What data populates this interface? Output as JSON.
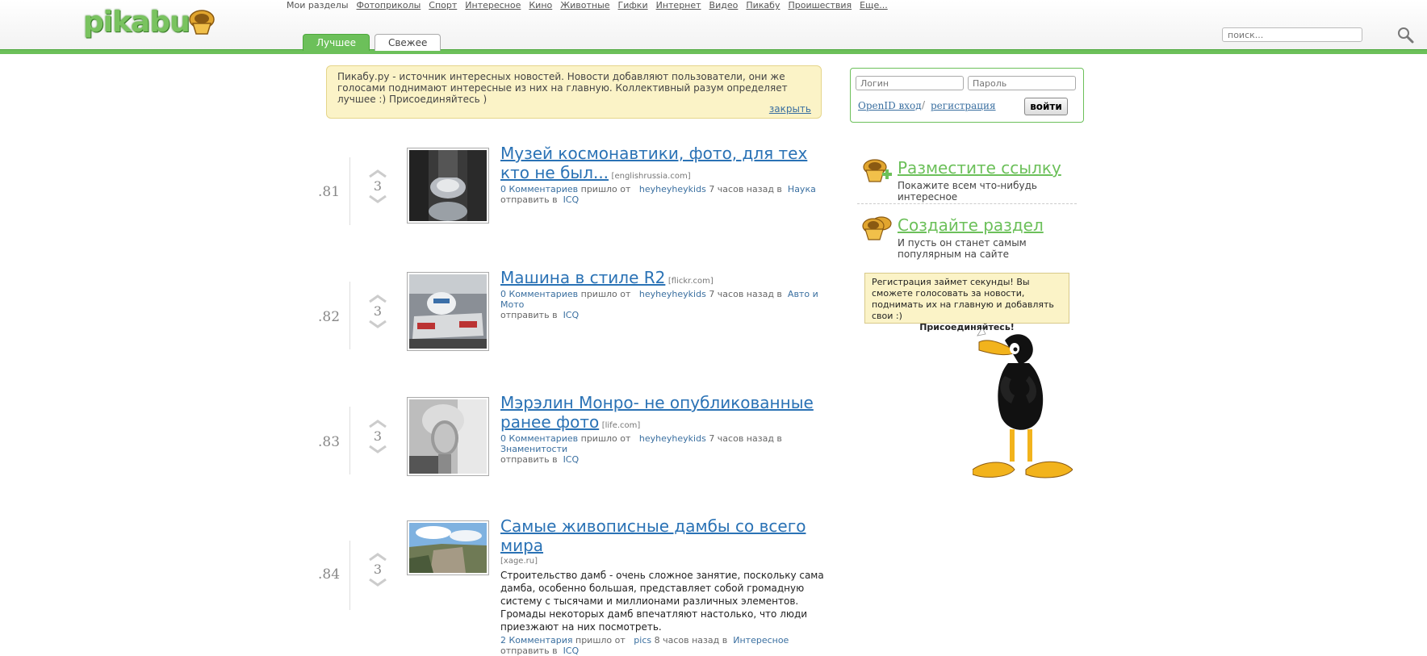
{
  "header": {
    "logo_text": "pikabu",
    "my_sections": "Мои разделы",
    "nav": [
      "Фотоприколы",
      "Спорт",
      "Интересное",
      "Кино",
      "Животные",
      "Гифки",
      "Интернет",
      "Видео",
      "Пикабу",
      "Проишествия",
      "Еще..."
    ],
    "tabs": [
      {
        "label": "Лучшее",
        "active": true
      },
      {
        "label": "Свежее",
        "active": false
      }
    ],
    "search_placeholder": "поиск...",
    "accent_color": "#6cc05a"
  },
  "notice": {
    "text": "Пикабу.ру - источник интересных новостей. Новости добавляют пользователи, они же голосами поднимают интересные из них на главную. Коллективный разум определяет лучшее :) Присоединяйтесь )",
    "close": "закрыть"
  },
  "login": {
    "login_placeholder": "Логин",
    "password_placeholder": "Пароль",
    "openid": "OpenID вход",
    "sep": "/",
    "register": "регистрация",
    "submit": "войти"
  },
  "stories": [
    {
      "rank": ".81",
      "score": "3",
      "title": "Музей космонавтики, фото, для тех кто не был...",
      "domain": "[englishrussia.com]",
      "desc": "",
      "comments": "0 Комментариев",
      "came_from": "пришло от",
      "user": "heyheyheykids",
      "time": "7 часов назад в",
      "category": "Наука",
      "send_to": "отправить в",
      "icq": "ICQ"
    },
    {
      "rank": ".82",
      "score": "3",
      "title": "Машина в стиле R2",
      "domain": "[flickr.com]",
      "desc": "",
      "comments": "0 Комментариев",
      "came_from": "пришло от",
      "user": "heyheyheykids",
      "time": "7 часов назад в",
      "category": "Авто и Мото",
      "send_to": "отправить в",
      "icq": "ICQ"
    },
    {
      "rank": ".83",
      "score": "3",
      "title": "Мэрэлин Монро- не опубликованные ранее фото",
      "domain": "[life.com]",
      "desc": "",
      "comments": "0 Комментариев",
      "came_from": "пришло от",
      "user": "heyheyheykids",
      "time": "7 часов назад в",
      "category": "Знаменитости",
      "send_to": "отправить в",
      "icq": "ICQ"
    },
    {
      "rank": ".84",
      "score": "3",
      "title": "Самые живописные дамбы со всего мира",
      "domain": "[xage.ru]",
      "desc": "Строительство дамб - очень сложное занятие, поскольку сама дамба, особенно большая, представляет собой громадную систему с тысячами и миллионами различных элементов. Громады некоторых дамб впечатляют настолько, что люди приезжают на них посмотреть.",
      "comments": "2 Комментария",
      "came_from": "пришло от",
      "user": "pics",
      "time": "8 часов назад в",
      "category": "Интересное",
      "send_to": "отправить в",
      "icq": "ICQ"
    }
  ],
  "sidebar": {
    "promo1": {
      "title": "Разместите ссылку",
      "desc": "Покажите всем что-нибудь интересное"
    },
    "promo2": {
      "title": "Создайте раздел",
      "desc": "И пусть он станет самым популярным на сайте"
    },
    "bubble_text": "Регистрация займет секунды! Вы сможете голосовать за новости, поднимать их на главную и добавлять свои :)",
    "bubble_bold": "Присоединяйтесь!"
  }
}
